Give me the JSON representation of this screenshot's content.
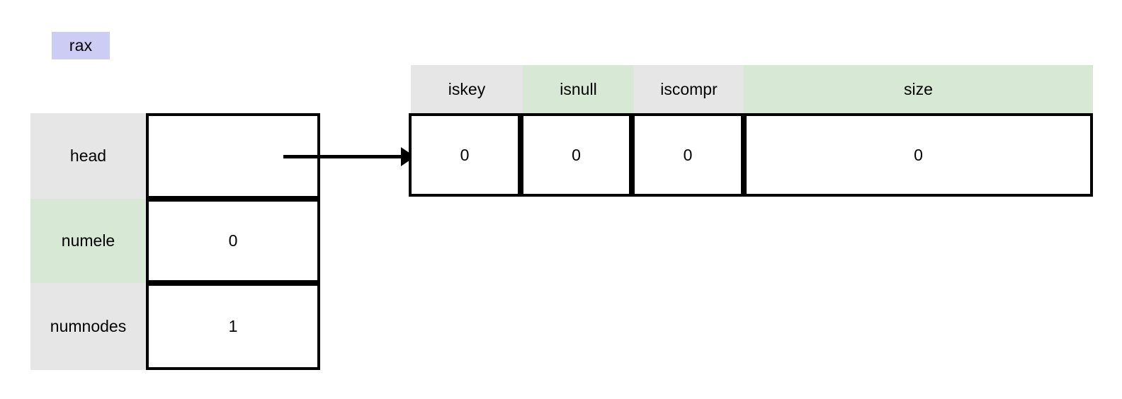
{
  "diagram": {
    "title": "rax radix tree struct pointing to an empty head node",
    "colors": {
      "register_badge_bg": "#ccccf5",
      "label_gray": "#e6e6e6",
      "label_green": "#d7e8d4",
      "border": "#000000",
      "cell_bg": "#ffffff",
      "page_bg": "#ffffff"
    }
  },
  "register": {
    "name": "rax"
  },
  "struct_table": {
    "rows": [
      {
        "label": "head",
        "value": "",
        "label_bg": "gray"
      },
      {
        "label": "numele",
        "value": "0",
        "label_bg": "green"
      },
      {
        "label": "numnodes",
        "value": "1",
        "label_bg": "gray"
      }
    ]
  },
  "pointer": {
    "icon": "arrow-right-icon",
    "from_field": "head",
    "to_node": "node_table"
  },
  "node_table": {
    "headers": [
      {
        "label": "iskey",
        "bg": "gray"
      },
      {
        "label": "isnull",
        "bg": "green"
      },
      {
        "label": "iscompr",
        "bg": "gray"
      },
      {
        "label": "size",
        "bg": "green"
      }
    ],
    "values": [
      "0",
      "0",
      "0",
      "0"
    ]
  }
}
